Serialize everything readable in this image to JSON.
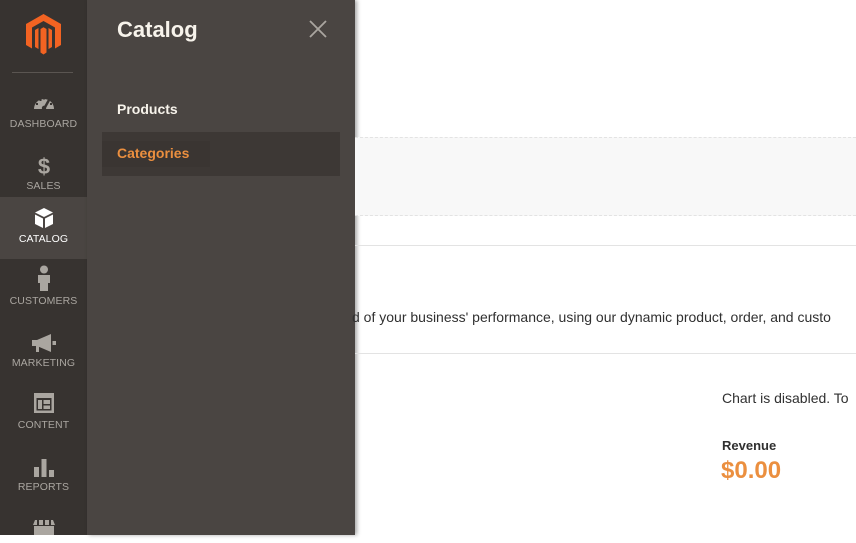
{
  "colors": {
    "sidebar_bg": "#373330",
    "flyout_bg": "#4a4542",
    "accent": "#eb8f3f",
    "logo": "#f26322"
  },
  "sidebar": {
    "logo_icon": "magento-logo-icon",
    "items": [
      {
        "label": "DASHBOARD",
        "icon": "speedometer-icon",
        "active": false
      },
      {
        "label": "SALES",
        "icon": "dollar-icon",
        "active": false
      },
      {
        "label": "CATALOG",
        "icon": "cube-icon",
        "active": true
      },
      {
        "label": "CUSTOMERS",
        "icon": "person-icon",
        "active": false
      },
      {
        "label": "MARKETING",
        "icon": "megaphone-icon",
        "active": false
      },
      {
        "label": "CONTENT",
        "icon": "layout-icon",
        "active": false
      },
      {
        "label": "REPORTS",
        "icon": "bar-chart-icon",
        "active": false
      },
      {
        "label": "",
        "icon": "store-icon",
        "active": false
      }
    ]
  },
  "flyout": {
    "title": "Catalog",
    "close_icon": "close-icon",
    "items": [
      {
        "label": "Products"
      },
      {
        "label": "Categories",
        "current": true
      }
    ]
  },
  "main": {
    "intro_text": "d of your business' performance, using our dynamic product, order, and custo",
    "chart_message": "Chart is disabled. To",
    "revenue_label": "Revenue",
    "revenue_value": "$0.00"
  }
}
